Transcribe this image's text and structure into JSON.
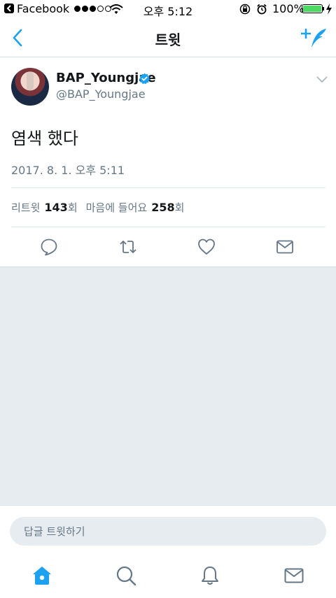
{
  "status_bar": {
    "back_app": "Facebook",
    "time": "오후 5:12",
    "battery": "100%",
    "signal_bars": 3,
    "battery_level": 1.0
  },
  "nav": {
    "title": "트윗",
    "back_icon": "chevron-left-icon",
    "compose_icon": "compose-tweet-icon"
  },
  "tweet": {
    "user_name": "BAP_Youngjae",
    "user_handle": "@BAP_Youngjae",
    "verified": true,
    "text": "염색 했다",
    "timestamp": "2017. 8. 1. 오후 5:11"
  },
  "stats": {
    "retweet_label": "리트윗",
    "retweet_count": "143",
    "retweet_unit": "회",
    "like_label": "마음에 들어요",
    "like_count": "258",
    "like_unit": "회"
  },
  "actions": [
    "reply-icon",
    "retweet-icon",
    "like-icon",
    "message-icon"
  ],
  "reply": {
    "placeholder": "답글 트윗하기"
  },
  "tabs": [
    "home-icon",
    "search-icon",
    "notifications-icon",
    "messages-icon"
  ],
  "colors": {
    "accent": "#1da1f2",
    "muted": "#657786",
    "background_gray": "#e6ecf0"
  }
}
